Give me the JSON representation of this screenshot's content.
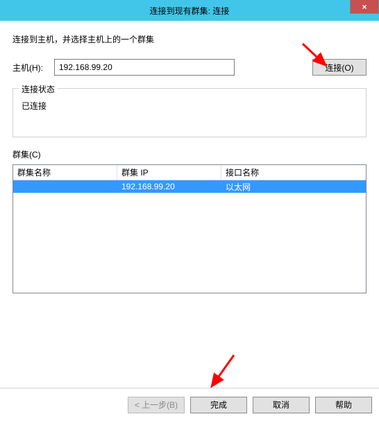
{
  "titlebar": {
    "title": "连接到现有群集: 连接",
    "close": "×"
  },
  "instruction": "连接到主机，并选择主机上的一个群集",
  "host": {
    "label": "主机(H):",
    "value": "192.168.99.20",
    "connect_label": "连接(O)"
  },
  "status": {
    "legend": "连接状态",
    "text": "已连接"
  },
  "clusters": {
    "label": "群集(C)",
    "headers": {
      "name": "群集名称",
      "ip": "群集 IP",
      "interface": "接口名称"
    },
    "rows": [
      {
        "name": "",
        "ip": "192.168.99.20",
        "interface": "以太网",
        "selected": true
      }
    ]
  },
  "buttons": {
    "back": "< 上一步(B)",
    "finish": "完成",
    "cancel": "取消",
    "help": "帮助"
  }
}
